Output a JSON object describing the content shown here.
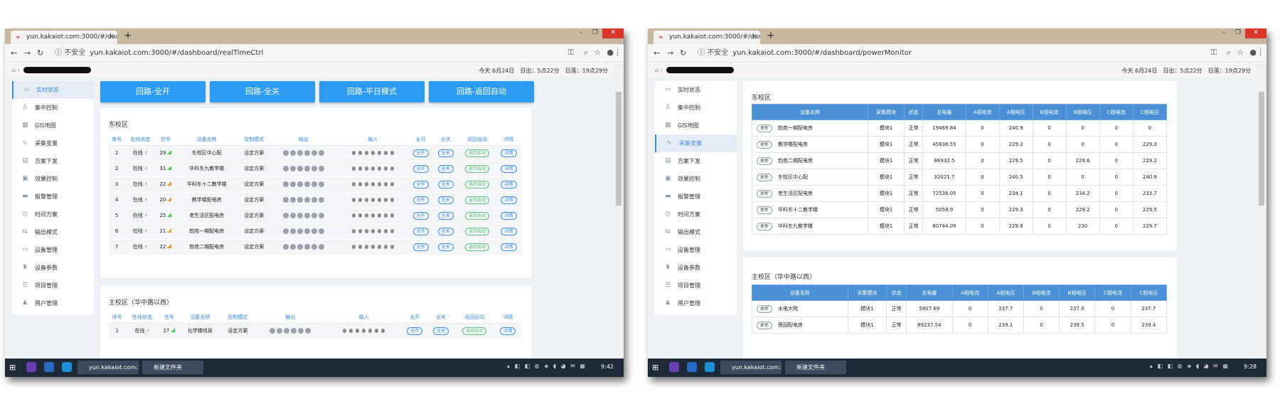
{
  "screen1": {
    "tab_title": "yun.kakaiot.com:3000/#/dashb",
    "url_insecure": "不安全",
    "url": "yun.kakaiot.com:3000/#/dashboard/realTimeCtrl",
    "date": "今天 6月24日",
    "sunrise": "日出：5点22分",
    "sunset": "日落：19点29分",
    "sidebar": [
      "实时状态",
      "集中控制",
      "GIS地图",
      "采集变量",
      "方案下发",
      "效果控制",
      "报警管理",
      "时间方案",
      "输出模式",
      "设备管理",
      "设备参数",
      "项目管理",
      "用户管理"
    ],
    "buttons": [
      "回路-全开",
      "回路-全关",
      "回路-平日模式",
      "回路-返回自动"
    ],
    "section1": "东校区",
    "section2": "主校区（华中路以西）",
    "headers": [
      "序号",
      "在线状态",
      "信号",
      "设备名称",
      "控制模式",
      "输出",
      "输入",
      "全开",
      "全关",
      "返回自动",
      "详情"
    ],
    "rows": [
      {
        "no": "1",
        "status": "在线",
        "signal": "29",
        "name": "东校区中心配",
        "mode": "设定方案"
      },
      {
        "no": "2",
        "status": "在线",
        "signal": "31",
        "name": "华科东九教学楼",
        "mode": "设定方案"
      },
      {
        "no": "3",
        "status": "在线",
        "signal": "22",
        "name": "华科东十二教学楼",
        "mode": "设定方案"
      },
      {
        "no": "4",
        "status": "在线",
        "signal": "20",
        "name": "教学楼配电房",
        "mode": "设定方案"
      },
      {
        "no": "5",
        "status": "在线",
        "signal": "25",
        "name": "老生活区配电房",
        "mode": "设定方案"
      },
      {
        "no": "6",
        "status": "在线",
        "signal": "21",
        "name": "韵苑一期配电房",
        "mode": "设定方案"
      },
      {
        "no": "7",
        "status": "在线",
        "signal": "22",
        "name": "韵苑二期配电房",
        "mode": "设定方案"
      }
    ],
    "rows2": [
      {
        "no": "1",
        "status": "在线",
        "signal": "27",
        "name": "化学楼喷泉",
        "mode": "设定方案"
      }
    ],
    "pill_on": "全开",
    "pill_off": "全关",
    "pill_auto": "返回自动",
    "pill_detail": "详情",
    "taskbar_chrome": "yun.kakaiot.com:30...",
    "taskbar_folder": "新建文件夹",
    "time": "9:42"
  },
  "screen2": {
    "tab_title": "yun.kakaiot.com:3000/#/dashb",
    "url_insecure": "不安全",
    "url": "yun.kakaiot.com:3000/#/dashboard/powerMonitor",
    "date": "今天 6月24日",
    "sunrise": "日出：5点22分",
    "sunset": "日落：19点29分",
    "sidebar": [
      "实时状态",
      "集中控制",
      "GIS地图",
      "采集变量",
      "方案下发",
      "效果控制",
      "报警管理",
      "时间方案",
      "输出模式",
      "设备管理",
      "设备参数",
      "项目管理",
      "用户管理"
    ],
    "section1": "东校区",
    "section2": "主校区（华中路以西）",
    "headers": [
      "设备名称",
      "采集模块",
      "状态",
      "总电量",
      "A相电流",
      "A相电压",
      "B相电流",
      "B相电压",
      "C相电流",
      "C相电压"
    ],
    "update": "更新",
    "rows": [
      [
        "韵苑一期配电房",
        "模块1",
        "正常",
        "19469.84",
        "0",
        "240.9",
        "0",
        "0",
        "0",
        "0"
      ],
      [
        "教学楼配电房",
        "模块1",
        "正常",
        "45836.55",
        "0",
        "229.2",
        "0",
        "0",
        "0",
        "229.3"
      ],
      [
        "韵苑二期配电房",
        "模块1",
        "正常",
        "86932.5",
        "0",
        "229.5",
        "0",
        "229.6",
        "0",
        "229.2"
      ],
      [
        "东校区中心配",
        "模块1",
        "正常",
        "32021.7",
        "0",
        "240.5",
        "0",
        "0",
        "0",
        "240.9"
      ],
      [
        "老生活区配电房",
        "模块1",
        "正常",
        "72538.05",
        "0",
        "234.1",
        "0",
        "234.2",
        "0",
        "233.7"
      ],
      [
        "华科东十二教学楼",
        "模块1",
        "正常",
        "5058.9",
        "0",
        "229.3",
        "0",
        "229.2",
        "0",
        "229.5"
      ],
      [
        "华科东九教学楼",
        "模块1",
        "正常",
        "80744.09",
        "0",
        "229.8",
        "0",
        "230",
        "0",
        "229.7"
      ]
    ],
    "rows2": [
      [
        "水电大院",
        "模块1",
        "正常",
        "5807.69",
        "0",
        "237.7",
        "0",
        "237.9",
        "0",
        "237.7"
      ],
      [
        "茜园配电房",
        "模块1",
        "正常",
        "89237.54",
        "0",
        "239.1",
        "0",
        "239.5",
        "0",
        "239.4"
      ]
    ],
    "taskbar_chrome": "yun.kakaiot.com:30...",
    "taskbar_folder": "新建文件夹",
    "time": "9:28"
  }
}
